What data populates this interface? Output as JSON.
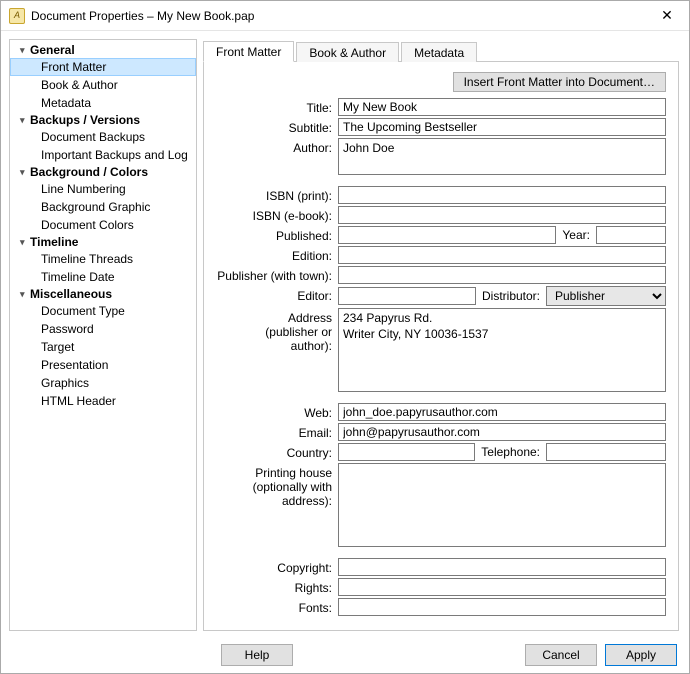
{
  "window": {
    "title": "Document Properties – My New Book.pap"
  },
  "sidebar": {
    "groups": [
      {
        "label": "General",
        "items": [
          "Front Matter",
          "Book & Author",
          "Metadata"
        ],
        "selected": 0
      },
      {
        "label": "Backups / Versions",
        "items": [
          "Document Backups",
          "Important Backups and Log"
        ]
      },
      {
        "label": "Background / Colors",
        "items": [
          "Line Numbering",
          "Background Graphic",
          "Document Colors"
        ]
      },
      {
        "label": "Timeline",
        "items": [
          "Timeline Threads",
          "Timeline Date"
        ]
      },
      {
        "label": "Miscellaneous",
        "items": [
          "Document Type",
          "Password",
          "Target",
          "Presentation",
          "Graphics",
          "HTML Header"
        ]
      }
    ]
  },
  "tabs": [
    "Front Matter",
    "Book & Author",
    "Metadata"
  ],
  "active_tab": 0,
  "insert_button": "Insert Front Matter into Document…",
  "form": {
    "title": {
      "label": "Title:",
      "value": "My New Book"
    },
    "subtitle": {
      "label": "Subtitle:",
      "value": "The Upcoming Bestseller"
    },
    "author": {
      "label": "Author:",
      "value": "John Doe"
    },
    "isbn_print": {
      "label": "ISBN (print):",
      "value": ""
    },
    "isbn_ebook": {
      "label": "ISBN (e-book):",
      "value": ""
    },
    "published": {
      "label": "Published:",
      "value": "",
      "year_label": "Year:",
      "year_value": ""
    },
    "edition": {
      "label": "Edition:",
      "value": ""
    },
    "publisher_town": {
      "label": "Publisher (with town):",
      "value": ""
    },
    "editor": {
      "label": "Editor:",
      "value": "",
      "distributor_label": "Distributor:",
      "distributor_value": "Publisher"
    },
    "address": {
      "label": "Address\n(publisher or\nauthor):",
      "value": "234 Papyrus Rd.\nWriter City, NY 10036-1537"
    },
    "web": {
      "label": "Web:",
      "value": "john_doe.papyrusauthor.com"
    },
    "email": {
      "label": "Email:",
      "value": "john@papyrusauthor.com"
    },
    "country": {
      "label": "Country:",
      "value": "",
      "tel_label": "Telephone:",
      "tel_value": ""
    },
    "printing": {
      "label": "Printing house\n(optionally with\naddress):",
      "value": ""
    },
    "copyright": {
      "label": "Copyright:",
      "value": ""
    },
    "rights": {
      "label": "Rights:",
      "value": ""
    },
    "fonts": {
      "label": "Fonts:",
      "value": ""
    }
  },
  "footer": {
    "help": "Help",
    "cancel": "Cancel",
    "apply": "Apply"
  }
}
